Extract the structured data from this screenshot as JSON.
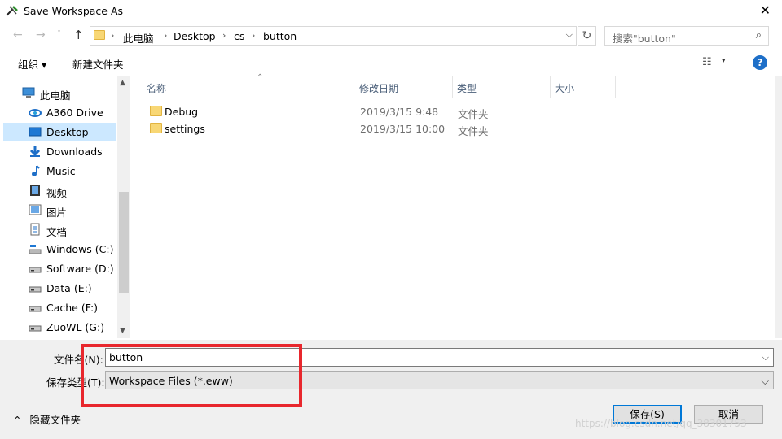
{
  "window": {
    "title": "Save Workspace As",
    "close_glyph": "✕"
  },
  "address": {
    "back_glyph": "←",
    "forward_glyph": "→",
    "forward_drop_glyph": "˅",
    "up_glyph": "↑",
    "crumbs": [
      "此电脑",
      "Desktop",
      "cs",
      "button"
    ],
    "sep_glyph": "›",
    "drop_glyph": "⌵",
    "refresh_glyph": "↻",
    "search_placeholder": "搜索\"button\"",
    "search_glyph": "⌕"
  },
  "toolbar": {
    "organize": "组织 ▾",
    "new_folder": "新建文件夹",
    "view_glyph": "☷",
    "view_drop_glyph": "▾",
    "help": "?"
  },
  "nav": {
    "items": [
      {
        "label": "此电脑",
        "icon": "this-pc-icon"
      },
      {
        "label": "A360 Drive",
        "icon": "cloud-drive-icon"
      },
      {
        "label": "Desktop",
        "icon": "desktop-icon"
      },
      {
        "label": "Downloads",
        "icon": "downloads-icon"
      },
      {
        "label": "Music",
        "icon": "music-icon"
      },
      {
        "label": "视频",
        "icon": "video-icon"
      },
      {
        "label": "图片",
        "icon": "pictures-icon"
      },
      {
        "label": "文档",
        "icon": "documents-icon"
      },
      {
        "label": "Windows (C:)",
        "icon": "drive-icon"
      },
      {
        "label": "Software (D:)",
        "icon": "drive-icon"
      },
      {
        "label": "Data (E:)",
        "icon": "drive-icon"
      },
      {
        "label": "Cache (F:)",
        "icon": "drive-icon"
      },
      {
        "label": "ZuoWL (G:)",
        "icon": "drive-icon"
      }
    ],
    "selected": "Desktop",
    "scroll_up_glyph": "▲",
    "scroll_down_glyph": "▼"
  },
  "files": {
    "columns": [
      "名称",
      "修改日期",
      "类型",
      "大小"
    ],
    "sort_glyph": "⌃",
    "rows": [
      {
        "name": "Debug",
        "date": "2019/3/15 9:48",
        "type": "文件夹"
      },
      {
        "name": "settings",
        "date": "2019/3/15 10:00",
        "type": "文件夹"
      }
    ]
  },
  "form": {
    "filename_label": "文件名(N):",
    "filename_value": "button",
    "filetype_label": "保存类型(T):",
    "filetype_value": "Workspace Files (*.eww)",
    "chevron_glyph": "⌵"
  },
  "footer": {
    "hide_folders": "隐藏文件夹",
    "hide_glyph": "⌃",
    "save": "保存(S)",
    "cancel": "取消",
    "watermark": "https://blog.csdn.net/qq_38301753"
  },
  "colors": {
    "highlight": "#e8272d",
    "accent": "#0078d7",
    "selection": "#cce8ff"
  }
}
